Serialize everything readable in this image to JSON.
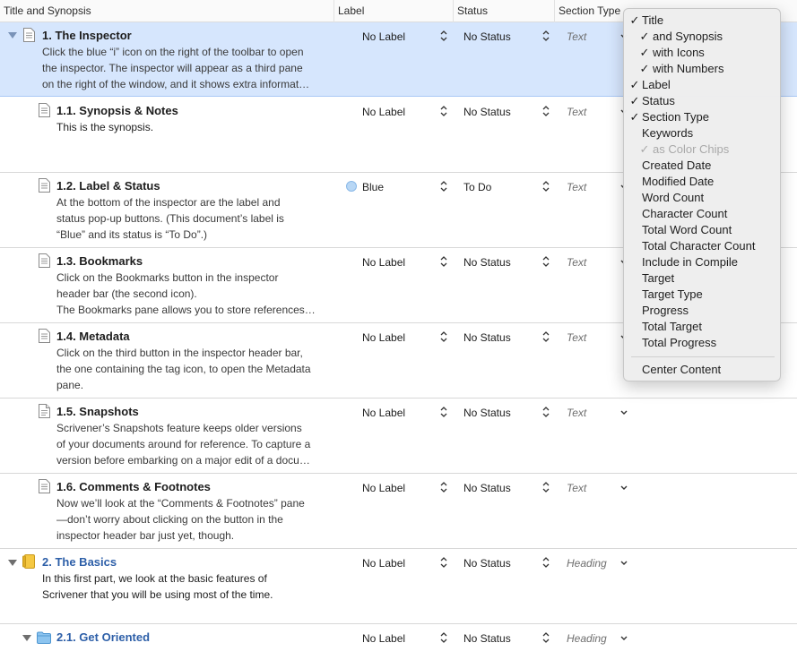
{
  "header": {
    "title_synopsis": "Title and Synopsis",
    "label": "Label",
    "status": "Status",
    "section_type": "Section Type"
  },
  "rows": [
    {
      "title": "1. The Inspector",
      "synopsis": [
        "Click the blue “i” icon on the right of the toolbar to open",
        "the inspector. The inspector will appear as a third pane",
        "on the right of the window, and it shows extra informat…"
      ],
      "label": "No Label",
      "status": "No Status",
      "section_type": "Text",
      "icon": "document-icon",
      "selected": true
    },
    {
      "title": "1.1. Synopsis & Notes",
      "synopsis": [
        "This is the synopsis."
      ],
      "label": "No Label",
      "status": "No Status",
      "section_type": "Text",
      "icon": "document-icon"
    },
    {
      "title": "1.2. Label & Status",
      "synopsis": [
        "At the bottom of the inspector are the label and",
        "status pop-up buttons. (This document’s label is",
        "“Blue” and its status is “To Do”.)"
      ],
      "label": "Blue",
      "status": "To Do",
      "section_type": "Text",
      "icon": "document-icon",
      "label_color": "#b8d7f5"
    },
    {
      "title": "1.3. Bookmarks",
      "synopsis": [
        "Click on the Bookmarks button in the inspector",
        "header bar (the second icon).",
        "The Bookmarks pane allows you to store references…"
      ],
      "label": "No Label",
      "status": "No Status",
      "section_type": "Text",
      "icon": "document-icon"
    },
    {
      "title": "1.4. Metadata",
      "synopsis": [
        "Click on the third button in the inspector header bar,",
        "the one containing the tag icon, to open the Metadata",
        "pane."
      ],
      "label": "No Label",
      "status": "No Status",
      "section_type": "Text",
      "icon": "document-icon"
    },
    {
      "title": "1.5. Snapshots",
      "synopsis": [
        "Scrivener’s Snapshots feature keeps older versions",
        "of your documents around for reference. To capture a",
        "version before embarking on a major edit of a docu…"
      ],
      "label": "No Label",
      "status": "No Status",
      "section_type": "Text",
      "icon": "snapshot-document-icon"
    },
    {
      "title": "1.6. Comments & Footnotes",
      "synopsis": [
        "Now we’ll look at the “Comments & Footnotes” pane",
        "—don’t worry about clicking on the button in the",
        "inspector header bar just yet, though."
      ],
      "label": "No Label",
      "status": "No Status",
      "section_type": "Text",
      "icon": "document-icon"
    },
    {
      "title": "2. The Basics",
      "synopsis": [
        "In this first part, we look at the basic features of",
        "Scrivener that you will be using most of the time."
      ],
      "label": "No Label",
      "status": "No Status",
      "section_type": "Heading",
      "icon": "part-notebook-icon"
    },
    {
      "title": "2.1. Get Oriented",
      "synopsis": [],
      "label": "No Label",
      "status": "No Status",
      "section_type": "Heading",
      "icon": "folder-icon"
    }
  ],
  "menu": {
    "items": [
      {
        "label": "Title",
        "checked": true
      },
      {
        "label": "and Synopsis",
        "checked": true,
        "indent": true
      },
      {
        "label": "with Icons",
        "checked": true,
        "indent": true
      },
      {
        "label": "with Numbers",
        "checked": true,
        "indent": true
      },
      {
        "label": "Label",
        "checked": true
      },
      {
        "label": "Status",
        "checked": true
      },
      {
        "label": "Section Type",
        "checked": true
      },
      {
        "label": "Keywords",
        "checked": false
      },
      {
        "label": "as Color Chips",
        "checked": true,
        "indent": true,
        "disabled": true
      },
      {
        "label": "Created Date",
        "checked": false
      },
      {
        "label": "Modified Date",
        "checked": false
      },
      {
        "label": "Word Count",
        "checked": false
      },
      {
        "label": "Character Count",
        "checked": false
      },
      {
        "label": "Total Word Count",
        "checked": false
      },
      {
        "label": "Total Character Count",
        "checked": false
      },
      {
        "label": "Include in Compile",
        "checked": false
      },
      {
        "label": "Target",
        "checked": false
      },
      {
        "label": "Target Type",
        "checked": false
      },
      {
        "label": "Progress",
        "checked": false
      },
      {
        "label": "Total Target",
        "checked": false
      },
      {
        "label": "Total Progress",
        "checked": false
      }
    ],
    "footer_item": "Center Content",
    "check_glyph": "✓"
  }
}
